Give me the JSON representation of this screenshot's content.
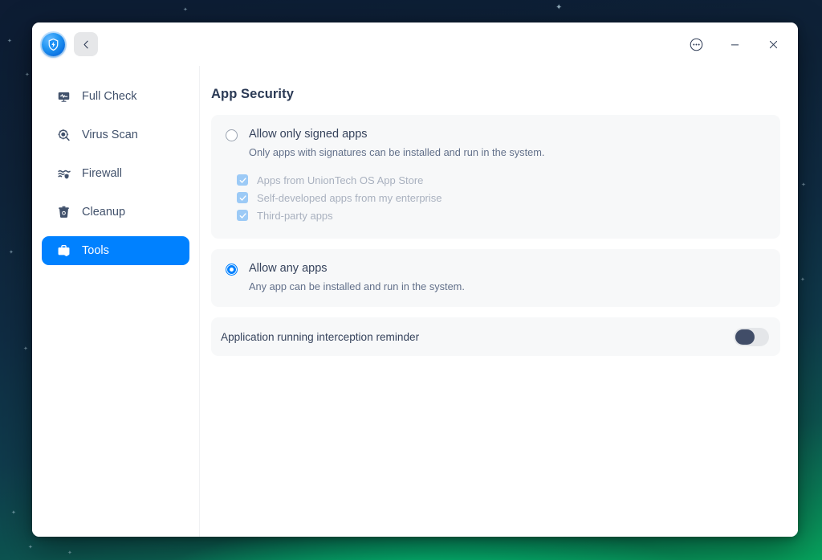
{
  "window": {
    "logo_icon": "shield-bolt-icon",
    "back_icon": "chevron-left-icon",
    "menu_icon": "more-options-icon",
    "minimize_icon": "minimize-icon",
    "close_icon": "close-icon"
  },
  "sidebar": {
    "items": [
      {
        "label": "Full Check",
        "icon": "monitor-pulse-icon",
        "active": false
      },
      {
        "label": "Virus Scan",
        "icon": "virus-magnifier-icon",
        "active": false
      },
      {
        "label": "Firewall",
        "icon": "firewall-shield-icon",
        "active": false
      },
      {
        "label": "Cleanup",
        "icon": "trash-bin-icon",
        "active": false
      },
      {
        "label": "Tools",
        "icon": "toolbox-shield-icon",
        "active": true
      }
    ]
  },
  "main": {
    "title": "App Security",
    "options": [
      {
        "title": "Allow only signed apps",
        "description": "Only apps with signatures can be installed and run in the system.",
        "selected": false,
        "sub_options": [
          {
            "label": "Apps from UnionTech OS App Store",
            "checked": true,
            "disabled": true
          },
          {
            "label": "Self-developed apps from my enterprise",
            "checked": true,
            "disabled": true
          },
          {
            "label": "Third-party apps",
            "checked": true,
            "disabled": true
          }
        ]
      },
      {
        "title": "Allow any apps",
        "description": "Any app can be installed and run in the system.",
        "selected": true,
        "sub_options": []
      }
    ],
    "reminder": {
      "label": "Application running interception reminder",
      "enabled": false
    }
  },
  "colors": {
    "accent": "#0081ff",
    "title_text": "#2b3a55",
    "card_bg": "#f7f8f9",
    "toggle_off_track": "#e4e6e9",
    "toggle_off_knob": "#414d68",
    "disabled_check": "#9ccaf6",
    "disabled_text": "#a9b1bf"
  }
}
